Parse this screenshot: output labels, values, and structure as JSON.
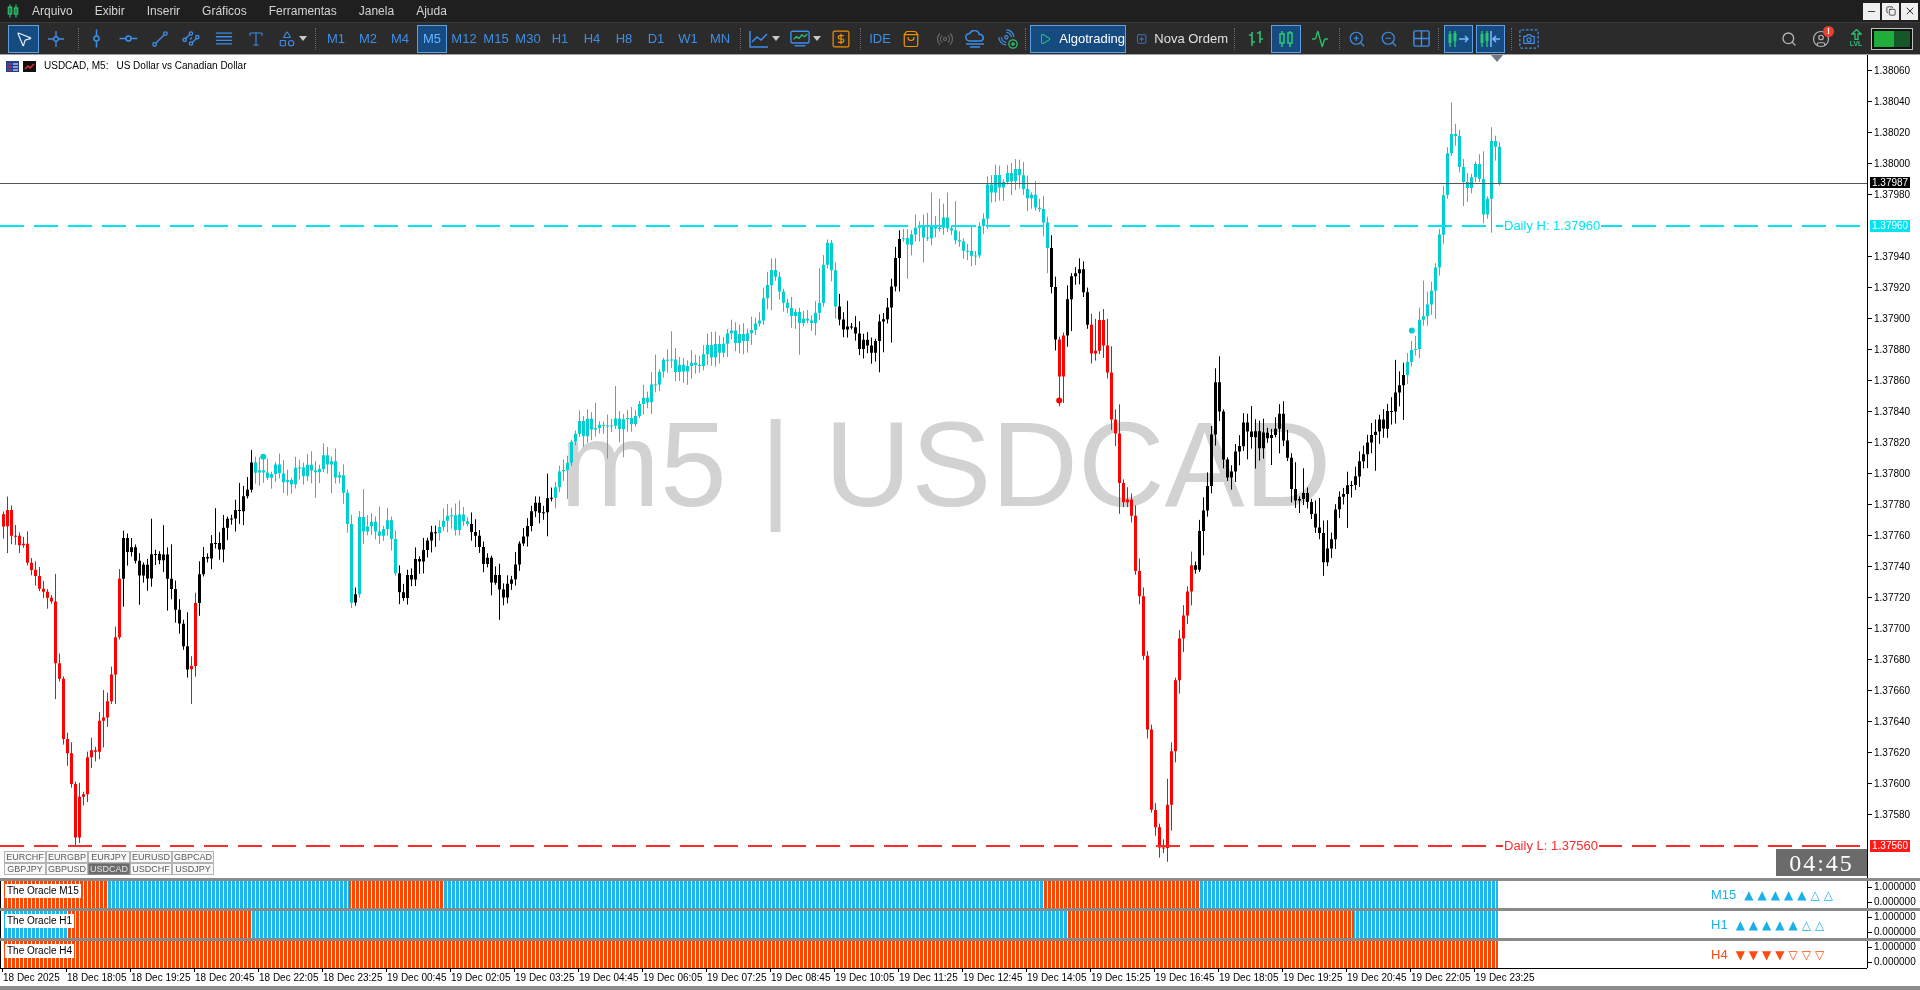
{
  "menu_bar": {
    "items": [
      "Arquivo",
      "Exibir",
      "Inserir",
      "Gráficos",
      "Ferramentas",
      "Janela",
      "Ajuda"
    ]
  },
  "toolbar": {
    "drawing_tools": [
      {
        "selected": true
      },
      {
        "selected": false
      },
      {
        "selected": false
      },
      {
        "selected": false
      },
      {
        "selected": false
      },
      {
        "selected": false
      },
      {
        "selected": false
      },
      {
        "selected": false
      },
      {
        "selected": false
      }
    ],
    "timeframes": [
      {
        "label": "M1",
        "selected": false
      },
      {
        "label": "M2",
        "selected": false
      },
      {
        "label": "M4",
        "selected": false
      },
      {
        "label": "M5",
        "selected": true
      },
      {
        "label": "M12",
        "selected": false
      },
      {
        "label": "M15",
        "selected": false
      },
      {
        "label": "M30",
        "selected": false
      },
      {
        "label": "H1",
        "selected": false
      },
      {
        "label": "H4",
        "selected": false
      },
      {
        "label": "H8",
        "selected": false
      },
      {
        "label": "D1",
        "selected": false
      },
      {
        "label": "W1",
        "selected": false
      },
      {
        "label": "MN",
        "selected": false
      }
    ],
    "ide": "IDE",
    "algotrading": {
      "label": "Algotrading",
      "on": true
    },
    "new_order": "Nova Ordem",
    "chart_types": [
      {
        "selected": false
      },
      {
        "selected": true
      },
      {
        "selected": false
      }
    ],
    "autoscroll": {
      "on": true
    },
    "chart_shift": {
      "on": true
    },
    "notification_badge": "!",
    "level_button": "LVL"
  },
  "chart": {
    "symbol": "USDCAD, M5:",
    "description": "US Dollar vs Canadian Dollar",
    "watermark": "m5 | USDCAD",
    "levels": [
      {
        "kind": "high",
        "label": "Daily H: 1.37960",
        "color": "#00e5f0"
      },
      {
        "kind": "low",
        "label": "Daily L: 1.37560",
        "color": "#ff2a2a"
      }
    ],
    "price_axis": {
      "slots": [
        {
          "kind": "tick",
          "label": "1.38060"
        },
        {
          "kind": "tick",
          "label": "1.38040"
        },
        {
          "kind": "tick",
          "label": "1.38020"
        },
        {
          "kind": "tick",
          "label": "1.38000"
        },
        {
          "kind": "tick",
          "label": "1.37980"
        },
        {
          "kind": "high",
          "label": "1.37960"
        },
        {
          "kind": "tick",
          "label": "1.37940"
        },
        {
          "kind": "tick",
          "label": "1.37920"
        },
        {
          "kind": "tick",
          "label": "1.37900"
        },
        {
          "kind": "tick",
          "label": "1.37880"
        },
        {
          "kind": "tick",
          "label": "1.37860"
        },
        {
          "kind": "tick",
          "label": "1.37840"
        },
        {
          "kind": "tick",
          "label": "1.37820"
        },
        {
          "kind": "tick",
          "label": "1.37800"
        },
        {
          "kind": "tick",
          "label": "1.37780"
        },
        {
          "kind": "tick",
          "label": "1.37760"
        },
        {
          "kind": "tick",
          "label": "1.37740"
        },
        {
          "kind": "tick",
          "label": "1.37720"
        },
        {
          "kind": "tick",
          "label": "1.37700"
        },
        {
          "kind": "tick",
          "label": "1.37680"
        },
        {
          "kind": "tick",
          "label": "1.37660"
        },
        {
          "kind": "tick",
          "label": "1.37640"
        },
        {
          "kind": "tick",
          "label": "1.37620"
        },
        {
          "kind": "tick",
          "label": "1.37600"
        },
        {
          "kind": "tick",
          "label": "1.37580"
        },
        {
          "kind": "low",
          "label": "1.37560"
        }
      ],
      "current_price": "1.37987"
    },
    "symbols": [
      {
        "label": "EURCHF",
        "selected": false
      },
      {
        "label": "EURGBP",
        "selected": false
      },
      {
        "label": "EURJPY",
        "selected": false
      },
      {
        "label": "EURUSD",
        "selected": false
      },
      {
        "label": "GBPCAD",
        "selected": false
      },
      {
        "label": "GBPJPY",
        "selected": false
      },
      {
        "label": "GBPUSD",
        "selected": false
      },
      {
        "label": "USDCAD",
        "selected": true
      },
      {
        "label": "USDCHF",
        "selected": false
      },
      {
        "label": "USDJPY",
        "selected": false
      }
    ],
    "countdown": "04:45"
  },
  "indicators": [
    {
      "label": "The Oracle M15",
      "timeframe": "M15",
      "arrows": "▲▲▲▲▲△△",
      "color": "#1ab0ea",
      "scale": [
        "1.000000",
        "0.000000"
      ]
    },
    {
      "label": "The Oracle H1",
      "timeframe": "H1",
      "arrows": "▲▲▲▲▲△△",
      "color": "#1ab0ea",
      "scale": [
        "1.000000",
        "0.000000"
      ]
    },
    {
      "label": "The Oracle H4",
      "timeframe": "H4",
      "arrows": "▼▼▼▼▽▽▽",
      "color": "#ff4a12",
      "scale": [
        "1.000000",
        "0.000000"
      ]
    }
  ],
  "time_axis": {
    "labels": [
      "18 Dec 2025",
      "18 Dec 18:05",
      "18 Dec 19:25",
      "18 Dec 20:45",
      "18 Dec 22:05",
      "18 Dec 23:25",
      "19 Dec 00:45",
      "19 Dec 02:05",
      "19 Dec 03:25",
      "19 Dec 04:45",
      "19 Dec 06:05",
      "19 Dec 07:25",
      "19 Dec 08:45",
      "19 Dec 10:05",
      "19 Dec 11:25",
      "19 Dec 12:45",
      "19 Dec 14:05",
      "19 Dec 15:25",
      "19 Dec 16:45",
      "19 Dec 18:05",
      "19 Dec 19:25",
      "19 Dec 20:45",
      "19 Dec 22:05",
      "19 Dec 23:25"
    ]
  }
}
